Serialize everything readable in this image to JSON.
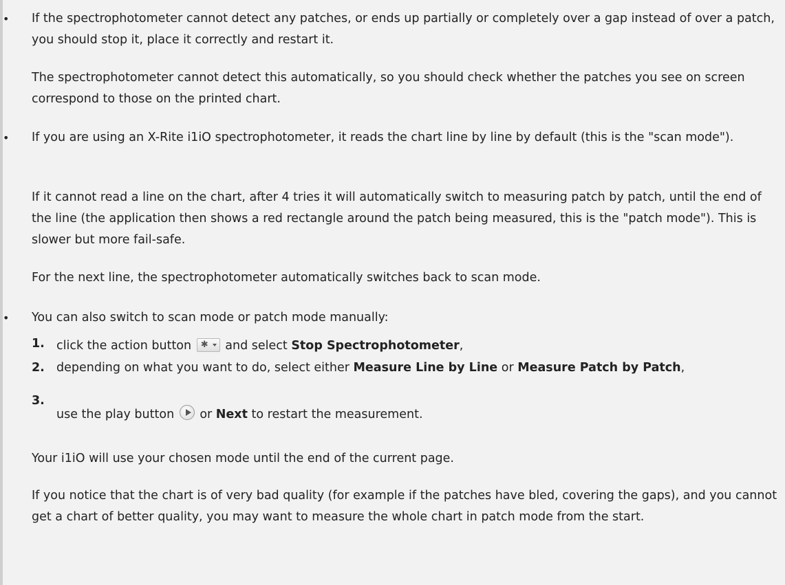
{
  "bullet_glyph": "•",
  "item1": {
    "p1": "If the spectrophotometer cannot detect any patches, or ends up partially or completely over a gap instead of over a patch, you should stop it, place it correctly and restart it.",
    "p2": "The spectrophotometer cannot detect this automatically, so you should check whether the patches you see on screen correspond to those on the printed chart."
  },
  "item2": {
    "p1": "If you are using an X-Rite i1iO spectrophotometer, it reads the chart line by line by default (this is the \"scan mode\").",
    "p2": "If it cannot read a line on the chart, after 4 tries it will automatically switch to measuring patch by patch, until the end of the line (the application then shows a red rectangle around the patch being measured, this is the \"patch mode\"). This is slower but more fail-safe.",
    "p3": "For the next line, the spectrophotometer automatically switches back to scan mode."
  },
  "item3": {
    "p1": "You can also switch to scan mode or patch mode manually:",
    "steps": [
      {
        "num": "1.",
        "text_before": "click the action button",
        "icon": "gear-dropdown-icon",
        "text_mid": "and select",
        "bold": "Stop Spectrophotometer",
        "text_after": ","
      },
      {
        "num": "2.",
        "text_before": "depending on what you want to do, select either",
        "bold1": "Measure Line by Line",
        "text_mid": "or",
        "bold2": "Measure Patch by Patch",
        "text_after": ","
      },
      {
        "num": "3.",
        "text_before": "use the play button",
        "icon": "play-icon",
        "text_mid": "or",
        "bold": "Next",
        "text_after": "to restart the measurement."
      }
    ],
    "p2": "Your i1iO will use your chosen mode until the end of the current page.",
    "p3": "If you notice that the chart is of very bad quality (for example if the patches have bled, covering the gaps), and you cannot get a chart of better quality, you may want to measure the whole chart in patch mode from the start."
  },
  "colors": {
    "background": "#f2f2f2",
    "text": "#222222",
    "rule": "#cfcfcf"
  }
}
